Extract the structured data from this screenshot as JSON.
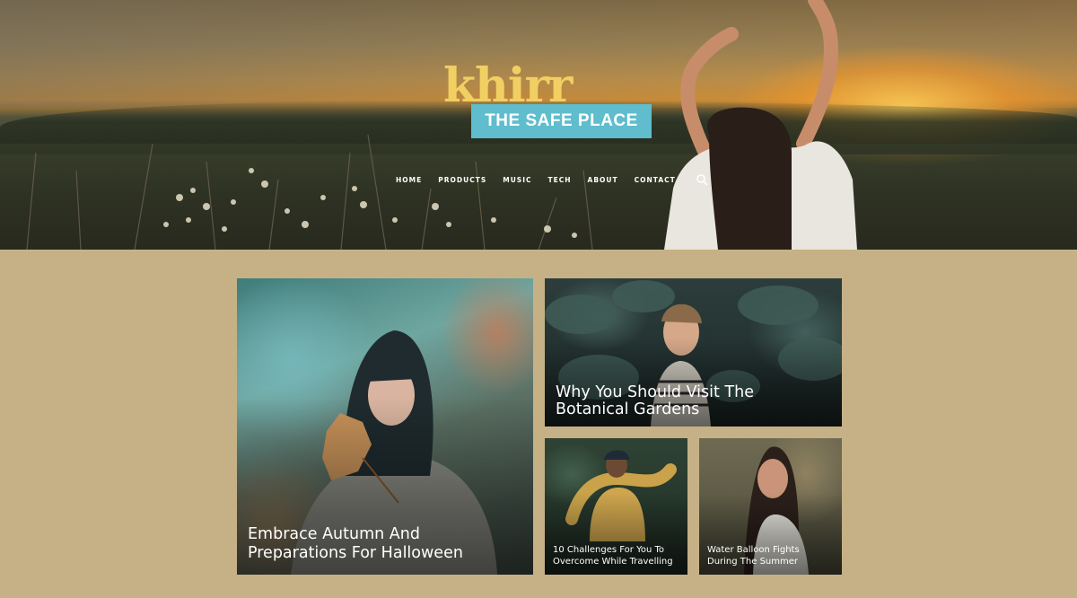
{
  "brand": {
    "name": "khirr",
    "tagline": "THE SAFE PLACE",
    "accent_color": "#5fbdcd",
    "script_color": "#f1cf62"
  },
  "nav": {
    "items": [
      "HOME",
      "PRODUCTS",
      "MUSIC",
      "TECH",
      "ABOUT",
      "CONTACT"
    ],
    "search_icon": "search-icon"
  },
  "page": {
    "background_color": "#c6b187"
  },
  "posts": [
    {
      "title": "Embrace Autumn And Preparations For Halloween"
    },
    {
      "title": "Why You Should Visit The Botanical Gardens"
    },
    {
      "title": "10 Challenges For You To Overcome While Travelling"
    },
    {
      "title": "Water Balloon Fights During The Summer"
    }
  ]
}
